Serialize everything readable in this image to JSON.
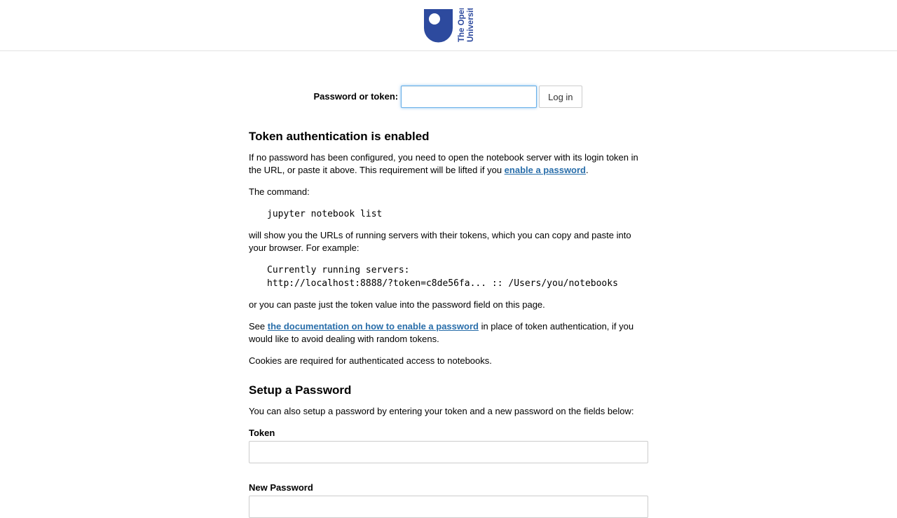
{
  "header": {
    "logo_text_line1": "The Open",
    "logo_text_line2": "University"
  },
  "login": {
    "label": "Password or token:",
    "input_value": "",
    "button_label": "Log in"
  },
  "token_auth": {
    "heading": "Token authentication is enabled",
    "p1_text": "If no password has been configured, you need to open the notebook server with its login token in the URL, or paste it above. This requirement will be lifted if you ",
    "p1_link": "enable a password",
    "p1_end": ".",
    "p2": "The command:",
    "command": "jupyter notebook list",
    "p3": "will show you the URLs of running servers with their tokens, which you can copy and paste into your browser. For example:",
    "example": "Currently running servers:\nhttp://localhost:8888/?token=c8de56fa... :: /Users/you/notebooks",
    "p4": "or you can paste just the token value into the password field on this page.",
    "p5_start": "See ",
    "p5_link": "the documentation on how to enable a password",
    "p5_end": " in place of token authentication, if you would like to avoid dealing with random tokens.",
    "p6": "Cookies are required for authenticated access to notebooks."
  },
  "setup": {
    "heading": "Setup a Password",
    "intro": "You can also setup a password by entering your token and a new password on the fields below:",
    "token_label": "Token",
    "token_value": "",
    "new_password_label": "New Password",
    "new_password_value": ""
  },
  "colors": {
    "link": "#296eaa",
    "logo_blue": "#2d4a9e",
    "focus_border": "#66afe9"
  }
}
